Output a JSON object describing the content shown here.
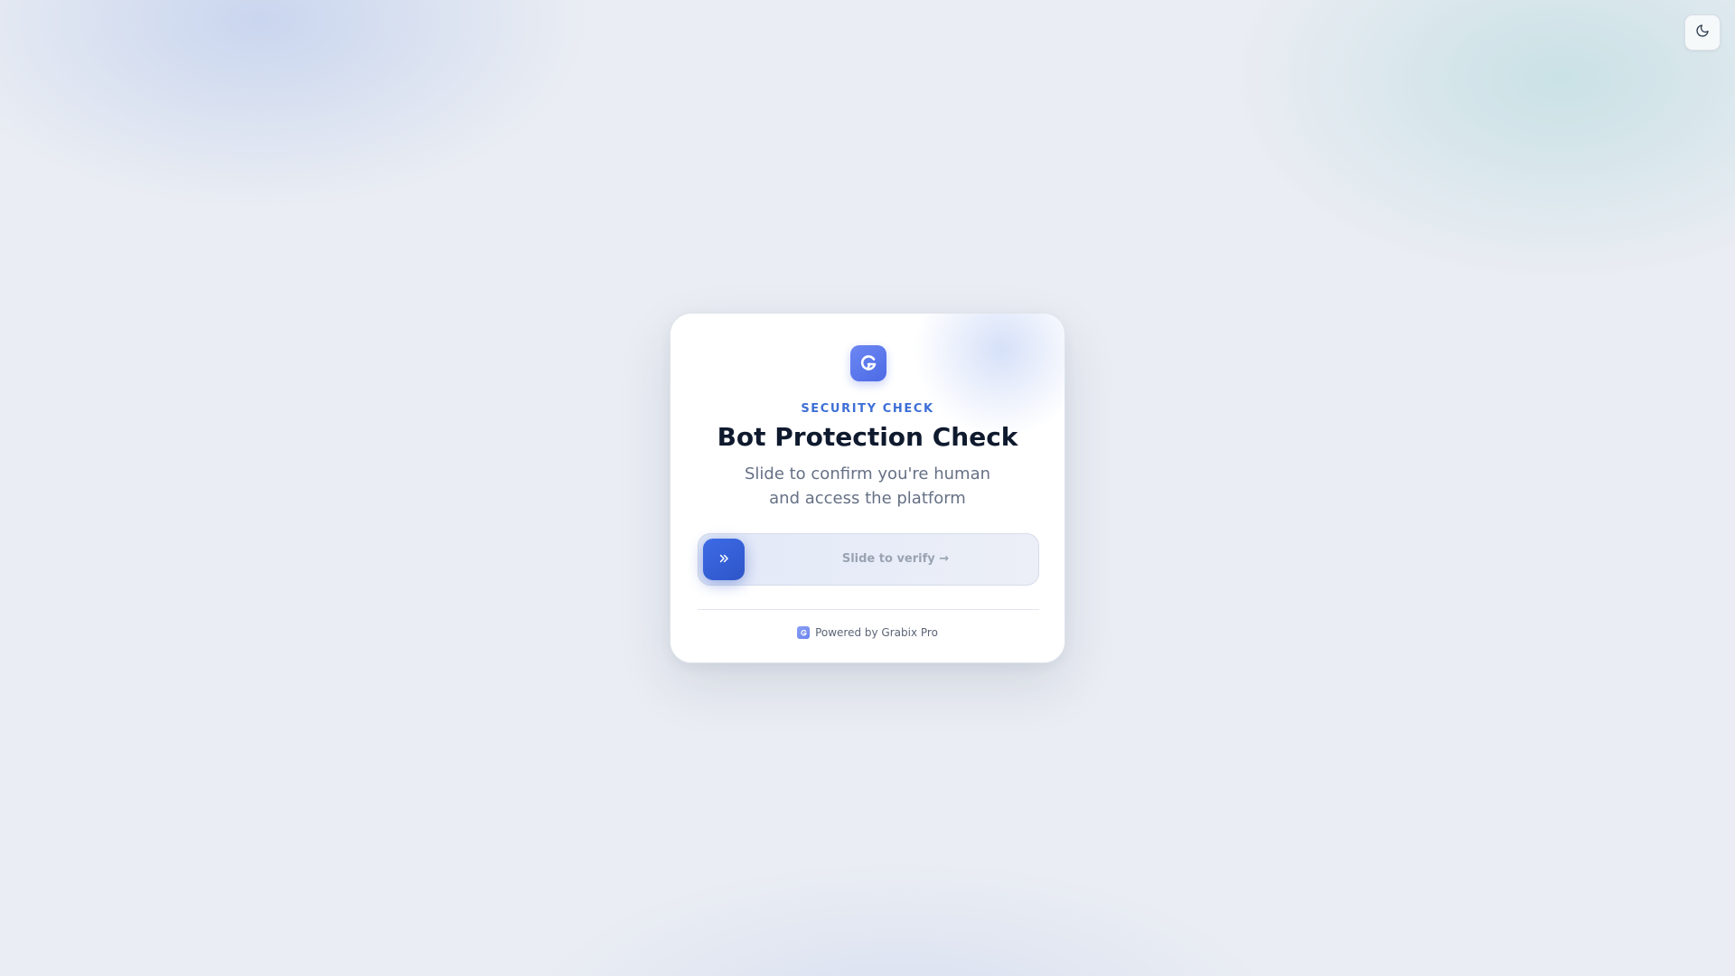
{
  "theme_toggle": {
    "icon": "moon-icon"
  },
  "card": {
    "logo_icon": "brand-logo-icon",
    "eyebrow": "SECURITY CHECK",
    "title": "Bot Protection Check",
    "subtitle_line1": "Slide to confirm you're human",
    "subtitle_line2": "and access the platform"
  },
  "slider": {
    "handle_icon": "chevrons-right-icon",
    "label": "Slide to verify →",
    "progress": 0
  },
  "footer": {
    "logo_icon": "brand-logo-icon",
    "text": "Powered by Grabix Pro"
  },
  "colors": {
    "accent": "#3d6fd6",
    "handle": "#2e55c8",
    "title": "#0f1a2e",
    "muted": "#667085"
  }
}
